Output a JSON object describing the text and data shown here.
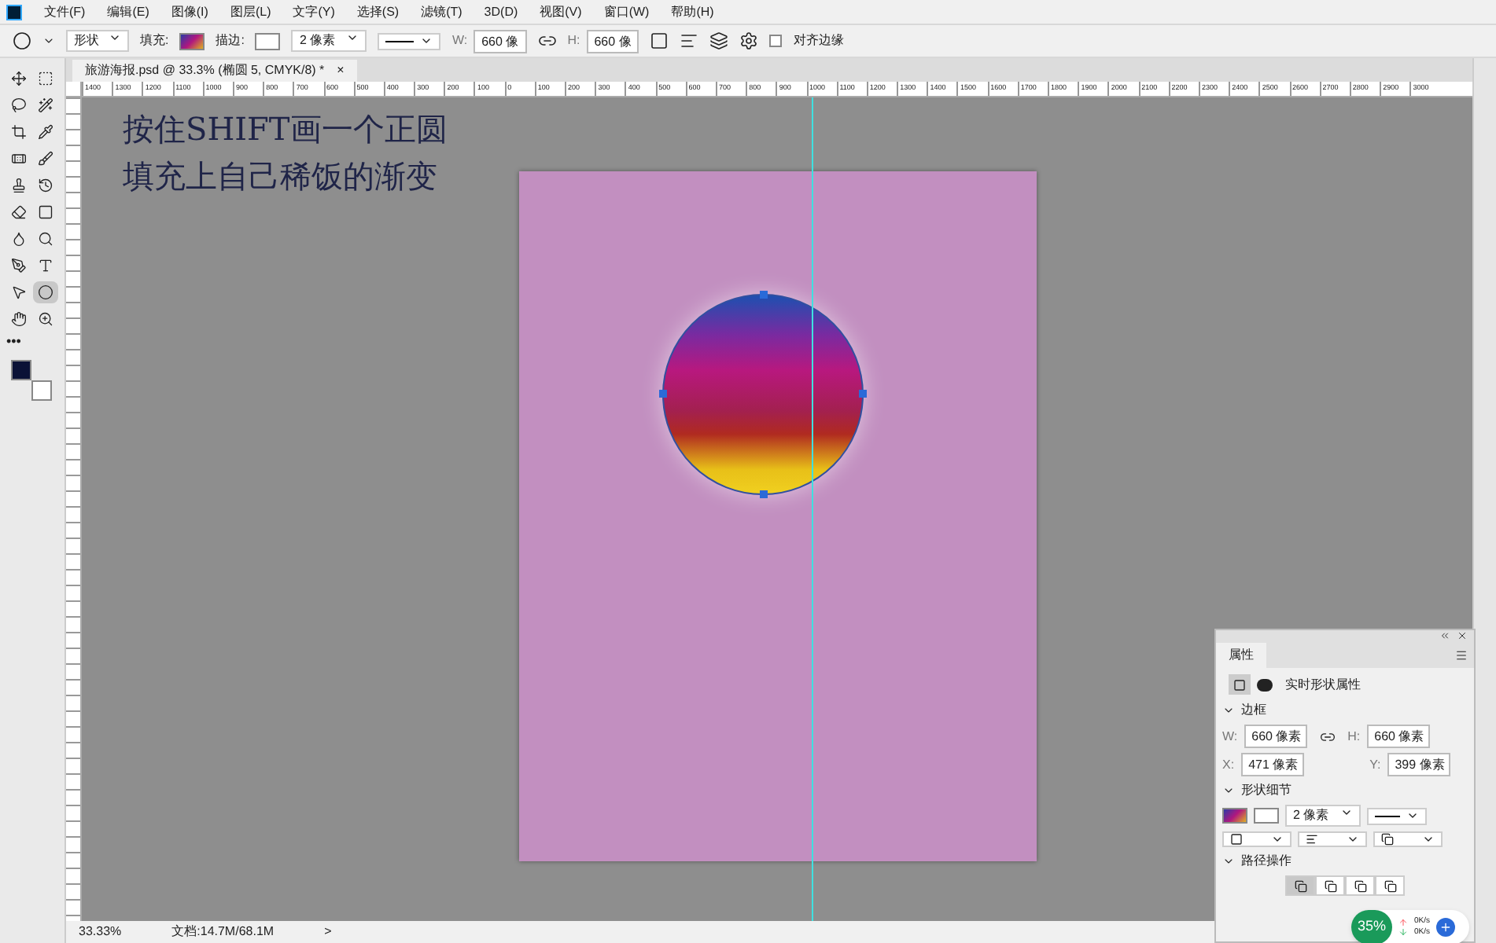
{
  "menu": [
    "文件(F)",
    "编辑(E)",
    "图像(I)",
    "图层(L)",
    "文字(Y)",
    "选择(S)",
    "滤镜(T)",
    "3D(D)",
    "视图(V)",
    "窗口(W)",
    "帮助(H)"
  ],
  "options_bar": {
    "mode": "形状",
    "fill_label": "填充:",
    "stroke_label": "描边:",
    "stroke_width": "2 像素",
    "w_label": "W:",
    "w_value": "660 像",
    "h_label": "H:",
    "h_value": "660 像",
    "align_edges": {
      "label": "对齐边缘",
      "checked": false
    }
  },
  "document_tab": {
    "title": "旅游海报.psd @ 33.3% (椭圆 5, CMYK/8) *",
    "close": "×"
  },
  "ruler_labels": [
    "1400",
    "1300",
    "1200",
    "1100",
    "1000",
    "900",
    "800",
    "700",
    "600",
    "500",
    "400",
    "300",
    "200",
    "100",
    "0",
    "100",
    "200",
    "300",
    "400",
    "500",
    "600",
    "700",
    "800",
    "900",
    "1000",
    "1100",
    "1200",
    "1300",
    "1400",
    "1500",
    "1600",
    "1700",
    "1800",
    "1900",
    "2000",
    "2100",
    "2200",
    "2300",
    "2400",
    "2500",
    "2600",
    "2700",
    "2800",
    "2900",
    "3000"
  ],
  "tools": [
    {
      "selected": false
    },
    {
      "selected": false
    },
    {
      "selected": false
    },
    {
      "selected": false
    },
    {
      "selected": false
    },
    {
      "selected": false
    },
    {
      "selected": false
    },
    {
      "selected": false
    },
    {
      "selected": false
    },
    {
      "selected": false
    },
    {
      "selected": false
    },
    {
      "selected": false
    },
    {
      "selected": false
    },
    {
      "selected": false
    },
    {
      "selected": false
    },
    {
      "selected": false
    },
    {
      "selected": false
    },
    {
      "selected": true
    },
    {
      "selected": false
    },
    {
      "selected": false
    }
  ],
  "more_tools": "•••",
  "canvas_notes": [
    "按住SHIFT画一个正圆",
    "填充上自己稀饭的渐变"
  ],
  "properties_panel": {
    "tab": "属性",
    "heading": "实时形状属性",
    "sections": [
      {
        "title": "边框"
      },
      {
        "title": "形状细节"
      },
      {
        "title": "路径操作"
      }
    ],
    "w_label": "W:",
    "w_value": "660 像素",
    "h_label": "H:",
    "h_value": "660 像素",
    "x_label": "X:",
    "x_value": "471 像素",
    "y_label": "Y:",
    "y_value": "399 像素",
    "stroke_width": "2 像素",
    "path_ops": [
      {
        "selected": true
      },
      {
        "selected": false
      },
      {
        "selected": false
      },
      {
        "selected": false
      }
    ]
  },
  "network_widget": {
    "percent": "35%",
    "up": "0K/s",
    "down": "0K/s"
  },
  "status_bar": {
    "zoom": "33.33%",
    "doc": "文档:14.7M/68.1M",
    "arrow": ">"
  }
}
